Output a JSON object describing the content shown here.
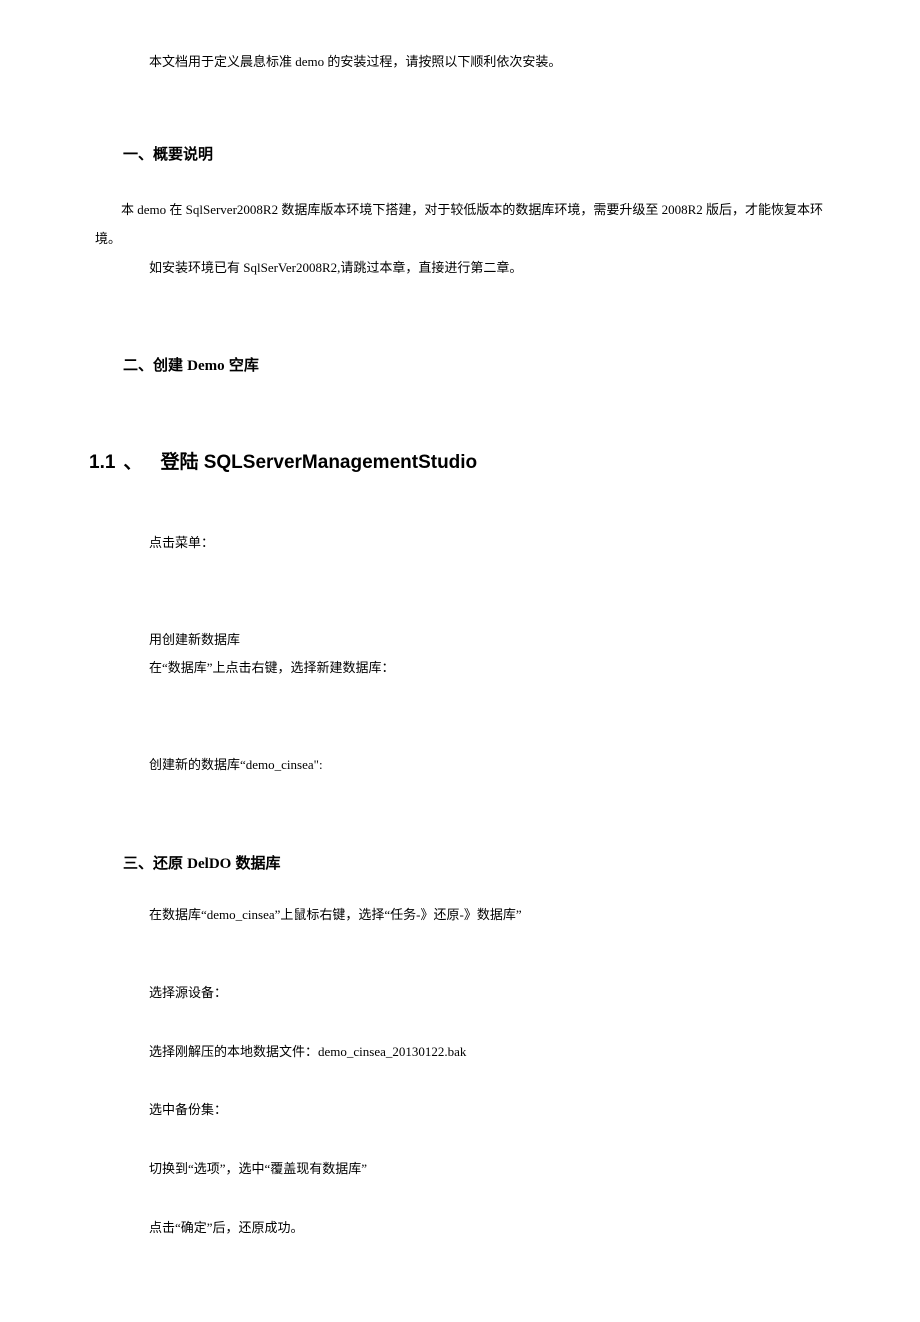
{
  "intro": "本文档用于定义晨息标准 demo 的安装过程，请按照以下顺利依次安装。",
  "section1": {
    "heading": "一、概要说明",
    "p1": "本 demo 在 SqlServer2008R2 数据库版本环境下搭建，对于较低版本的数据库环境，需要升级至 2008R2 版后，才能恢复本环境。",
    "p2": "如安装环境已有 SqlSerVer2008R2,请跳过本章，直接进行第二章。"
  },
  "section2": {
    "heading_prefix": "二、创建 ",
    "heading_bold": "Demo",
    "heading_suffix": " 空库",
    "subheading_number": "1.1",
    "subheading_dot": "、",
    "subheading_text": "登陆 SQLServerManagementStudio",
    "step1": "点击菜单：",
    "step2a": "用创建新数据库",
    "step2b": "在“数据库”上点击右键，选择新建数据库：",
    "step3": "创建新的数据库“demo_cinsea\":"
  },
  "section3": {
    "heading_prefix": "三、还原 ",
    "heading_bold": "DelDO",
    "heading_suffix": " 数据库",
    "step1": "在数据库“demo_cinsea”上鼠标右键，选择“任务-》还原-》数据库”",
    "step2": "选择源设备：",
    "step3": "选择刚解压的本地数据文件：demo_cinsea_20130122.bak",
    "step4": "选中备份集：",
    "step5": "切换到“选项”，选中“覆盖现有数据库”",
    "step6": "点击“确定”后，还原成功。"
  }
}
